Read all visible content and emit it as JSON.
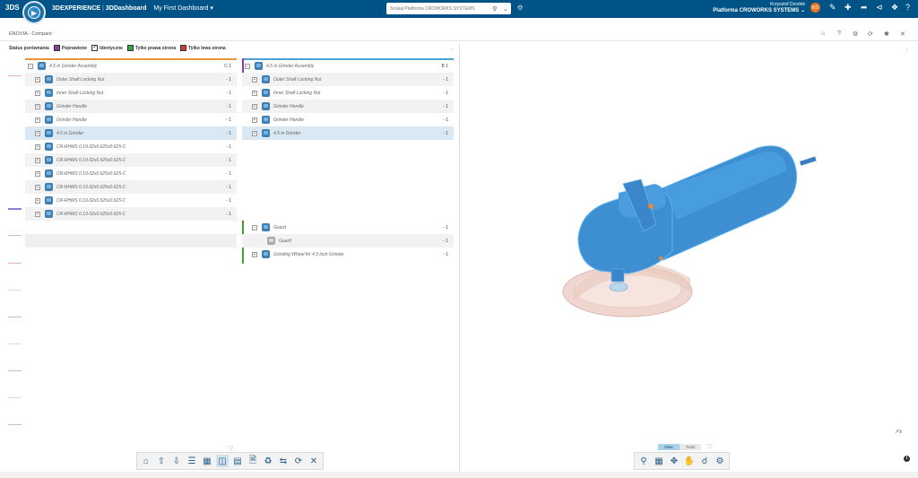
{
  "topbar": {
    "ds_logo": "3DS",
    "brand_main": "3DEXPERIENCE",
    "brand_app": "3DDashboard",
    "dashboard": "My First Dashboard",
    "search_placeholder": "Szukaj Platforma CROWORKS SYSTEMS",
    "user_name": "Krzysztof Dzodek",
    "platform": "Platforma CROWORKS SYSTEMS",
    "avatar": "KD"
  },
  "widget": {
    "title": "ENOVIA - Compare"
  },
  "legend": {
    "label": "Status porównania",
    "items": [
      {
        "label": "Poprawione",
        "color": "#8b3a9e"
      },
      {
        "label": "Identyczne",
        "color": "#ffffff"
      },
      {
        "label": "Tylko prawa strona",
        "color": "#3aa23a"
      },
      {
        "label": "Tylko lewa strona",
        "color": "#d43a3a"
      }
    ]
  },
  "left_tree": {
    "rows": [
      {
        "name": "4.5 in Grinder Assembly",
        "qty": "C 1",
        "level": 0
      },
      {
        "name": "Outer Shaft Locking Nut",
        "qty": "- 1",
        "level": 1
      },
      {
        "name": "Inner Shaft Locking Nut",
        "qty": "- 1",
        "level": 1
      },
      {
        "name": "Grinder Handle",
        "qty": "- 1",
        "level": 1
      },
      {
        "name": "Grinder Handle",
        "qty": "- 1",
        "level": 1
      },
      {
        "name": "4.5 in Grinder",
        "qty": "- 1",
        "level": 1
      },
      {
        "name": "CR-RHMS 0.19-32x0.625x0.625-C",
        "qty": "- 1",
        "level": 1
      },
      {
        "name": "CR-RHMS 0.19-32x0.625x0.625-C",
        "qty": "- 1",
        "level": 1
      },
      {
        "name": "CR-RHMS 0.19-32x0.625x0.625-C",
        "qty": "- 1",
        "level": 1
      },
      {
        "name": "CR-RHMS 0.19-32x0.625x0.625-C",
        "qty": "- 1",
        "level": 1
      },
      {
        "name": "CR-RHMS 0.19-32x0.625x0.625-C",
        "qty": "- 1",
        "level": 1
      },
      {
        "name": "CR-RHMS 0.19-32x0.625x0.625-C",
        "qty": "- 1",
        "level": 1
      }
    ]
  },
  "right_tree": {
    "rows": [
      {
        "name": "4.5 in Grinder Assembly",
        "qty": "B 1",
        "level": 0
      },
      {
        "name": "Outer Shaft Locking Nut",
        "qty": "- 1",
        "level": 1
      },
      {
        "name": "Inner Shaft Locking Nut",
        "qty": "- 1",
        "level": 1
      },
      {
        "name": "Grinder Handle",
        "qty": "- 1",
        "level": 1
      },
      {
        "name": "Grinder Handle",
        "qty": "- 1",
        "level": 1
      },
      {
        "name": "4.5 in Grinder",
        "qty": "- 1",
        "level": 1
      },
      {
        "name": "Guard",
        "qty": "- 1",
        "level": 1
      },
      {
        "name": "Guard",
        "qty": "- 1",
        "level": 2
      },
      {
        "name": "Grinding Wheel for 4.5 inch Grinder",
        "qty": "- 1",
        "level": 1
      }
    ]
  },
  "viewer": {
    "tab_view": "View",
    "tab_tools": "Tools",
    "axis_label": "x",
    "info": "i"
  },
  "colors": {
    "topbar": "#005386",
    "modified": "#8b3a9e",
    "right_only": "#3aa23a",
    "left_only": "#d43a3a",
    "selected_row": "#d9e8f2",
    "model_blue": "#3d8fd1"
  }
}
